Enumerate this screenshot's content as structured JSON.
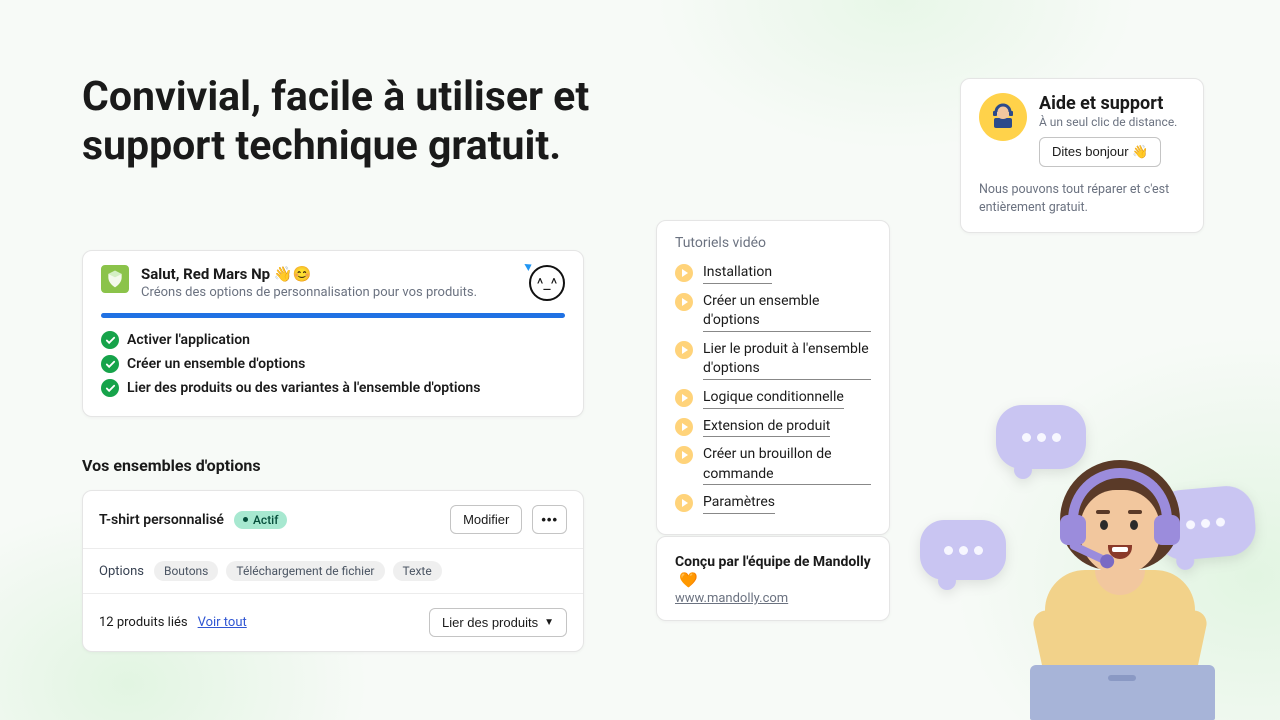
{
  "headline": "Convivial, facile à utiliser et support technique gratuit.",
  "greeting": {
    "title": "Salut, Red Mars Np 👋😊",
    "subtitle": "Créons des options de personnalisation pour vos produits.",
    "avatar_face": "^_^",
    "checks": [
      "Activer l'application",
      "Créer un ensemble d'options",
      "Lier des produits ou des variantes à l'ensemble d'options"
    ]
  },
  "option_sets": {
    "heading": "Vos ensembles d'options",
    "item": {
      "name": "T-shirt personnalisé",
      "status": "Actif",
      "edit_label": "Modifier",
      "more_label": "•••",
      "options_label": "Options",
      "chips": [
        "Boutons",
        "Téléchargement de fichier",
        "Texte"
      ],
      "linked_text": "12 produits liés",
      "view_all": "Voir tout",
      "link_products": "Lier des produits"
    }
  },
  "tutorials": {
    "heading": "Tutoriels vidéo",
    "items": [
      "Installation",
      "Créer un ensemble d'options",
      "Lier le produit à l'ensemble d'options",
      "Logique conditionnelle",
      "Extension de produit",
      "Créer un brouillon de commande",
      "Paramètres"
    ]
  },
  "credit": {
    "title": "Conçu par l'équipe de Mandolly",
    "heart": "🧡",
    "link": "www.mandolly.com"
  },
  "help": {
    "title": "Aide et support",
    "subtitle": "À un seul clic de distance.",
    "button": "Dites bonjour 👋",
    "footer": "Nous pouvons tout réparer et c'est entièrement gratuit."
  }
}
